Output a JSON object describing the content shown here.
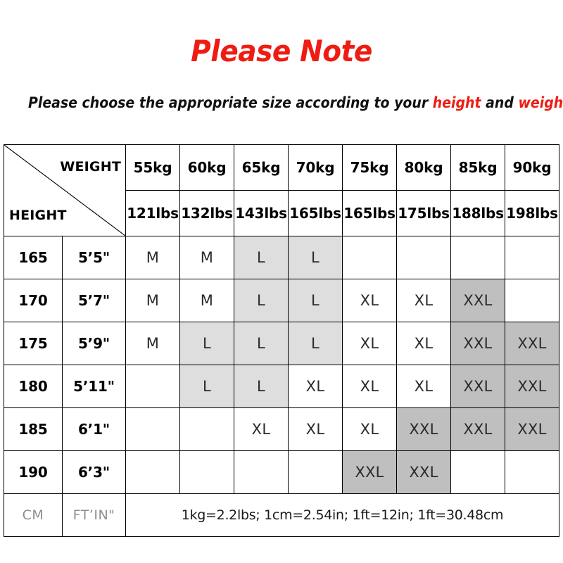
{
  "heading": {
    "title": "Please Note",
    "subtitle_before": "Please choose the appropriate size according to your ",
    "subtitle_hl1": "height",
    "subtitle_middle": " and ",
    "subtitle_hl2": "weight"
  },
  "colors": {
    "title_red": "#ee1c12",
    "highlight_red": "#ee1c12",
    "cell_l_gray": "#dedede",
    "cell_xxl_gray": "#bfbfbf",
    "border": "#000000",
    "footer_label_gray": "#8e8e8e"
  },
  "table": {
    "corner": {
      "weight_label": "WEIGHT",
      "height_label": "HEIGHT"
    },
    "weight_kg": [
      "55kg",
      "60kg",
      "65kg",
      "70kg",
      "75kg",
      "80kg",
      "85kg",
      "90kg"
    ],
    "weight_lbs": [
      "121lbs",
      "132lbs",
      "143lbs",
      "165lbs",
      "165lbs",
      "175lbs",
      "188lbs",
      "198lbs"
    ],
    "rows": [
      {
        "cm": "165",
        "ft": "5’5\"",
        "sizes": [
          "M",
          "M",
          "L",
          "L",
          "",
          "",
          "",
          ""
        ]
      },
      {
        "cm": "170",
        "ft": "5’7\"",
        "sizes": [
          "M",
          "M",
          "L",
          "L",
          "XL",
          "XL",
          "XXL",
          ""
        ]
      },
      {
        "cm": "175",
        "ft": "5’9\"",
        "sizes": [
          "M",
          "L",
          "L",
          "L",
          "XL",
          "XL",
          "XXL",
          "XXL"
        ]
      },
      {
        "cm": "180",
        "ft": "5’11\"",
        "sizes": [
          "",
          "L",
          "L",
          "XL",
          "XL",
          "XL",
          "XXL",
          "XXL"
        ]
      },
      {
        "cm": "185",
        "ft": "6’1\"",
        "sizes": [
          "",
          "",
          "XL",
          "XL",
          "XL",
          "XXL",
          "XXL",
          "XXL"
        ]
      },
      {
        "cm": "190",
        "ft": "6’3\"",
        "sizes": [
          "",
          "",
          "",
          "",
          "XXL",
          "XXL",
          "",
          ""
        ]
      }
    ],
    "footer": {
      "cm_label": "CM",
      "ft_label": "FT’IN\"",
      "note": "1kg=2.2lbs; 1cm=2.54in; 1ft=12in; 1ft=30.48cm"
    }
  }
}
